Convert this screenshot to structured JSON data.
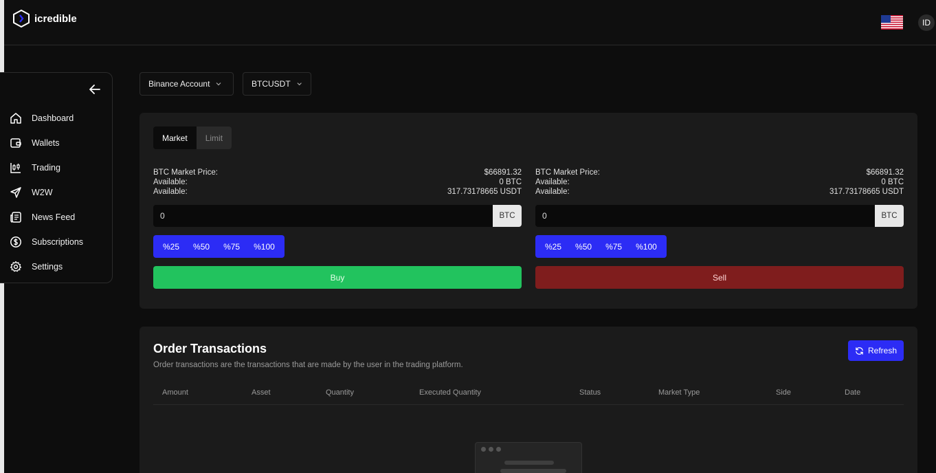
{
  "brand": {
    "name": "icredible"
  },
  "header": {
    "avatar_initials": "ID"
  },
  "sidebar": {
    "items": [
      {
        "label": "Dashboard",
        "icon": "home-icon"
      },
      {
        "label": "Wallets",
        "icon": "wallet-icon"
      },
      {
        "label": "Trading",
        "icon": "candlestick-icon"
      },
      {
        "label": "W2W",
        "icon": "send-icon"
      },
      {
        "label": "News Feed",
        "icon": "newspaper-icon"
      },
      {
        "label": "Subscriptions",
        "icon": "dollar-circle-icon"
      },
      {
        "label": "Settings",
        "icon": "gear-icon"
      }
    ]
  },
  "selectors": {
    "account": "Binance Account",
    "pair": "BTCUSDT"
  },
  "order_form": {
    "tabs": [
      "Market",
      "Limit"
    ],
    "active_tab": "Market",
    "buy": {
      "price_label": "BTC Market Price:",
      "price_value": "$66891.32",
      "avail1_label": "Available:",
      "avail1_value": "0 BTC",
      "avail2_label": "Available:",
      "avail2_value": "317.73178665 USDT",
      "amount_value": "0",
      "unit": "BTC",
      "percents": [
        "%25",
        "%50",
        "%75",
        "%100"
      ],
      "action_label": "Buy"
    },
    "sell": {
      "price_label": "BTC Market Price:",
      "price_value": "$66891.32",
      "avail1_label": "Available:",
      "avail1_value": "0 BTC",
      "avail2_label": "Available:",
      "avail2_value": "317.73178665 USDT",
      "amount_value": "0",
      "unit": "BTC",
      "percents": [
        "%25",
        "%50",
        "%75",
        "%100"
      ],
      "action_label": "Sell"
    }
  },
  "orders": {
    "title": "Order Transactions",
    "description": "Order transactions are the transactions that are made by the user in the trading platform.",
    "refresh_label": "Refresh",
    "columns": [
      "Amount",
      "Asset",
      "Quantity",
      "Executed Quantity",
      "Status",
      "Market Type",
      "Side",
      "Date"
    ]
  },
  "colors": {
    "accent_blue": "#2c2cf5",
    "buy_green": "#22c35e",
    "sell_red": "#7f1d1d",
    "panel_bg": "#1b1b1b",
    "page_bg": "#0d0d0d"
  }
}
